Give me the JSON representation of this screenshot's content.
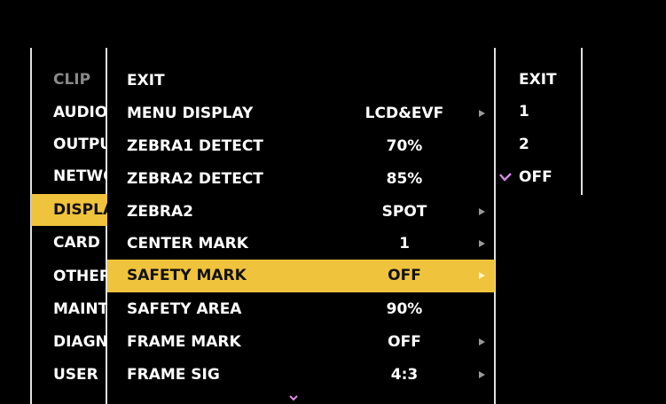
{
  "left_menu": {
    "items": [
      {
        "label": "CLIP"
      },
      {
        "label": "AUDIO"
      },
      {
        "label": "OUTPUT"
      },
      {
        "label": "NETWORK"
      },
      {
        "label": "DISPLAY"
      },
      {
        "label": "CARD"
      },
      {
        "label": "OTHERS"
      },
      {
        "label": "MAINTENANCE"
      },
      {
        "label": "DIAGNOSTIC"
      },
      {
        "label": "USER"
      }
    ],
    "selected": "DISPLAY",
    "dimmed": "CLIP"
  },
  "middle_menu": {
    "items": [
      {
        "label": "EXIT",
        "value": ""
      },
      {
        "label": "MENU DISPLAY",
        "value": "LCD&EVF"
      },
      {
        "label": "ZEBRA1 DETECT",
        "value": "70%"
      },
      {
        "label": "ZEBRA2 DETECT",
        "value": "85%"
      },
      {
        "label": "ZEBRA2",
        "value": "SPOT"
      },
      {
        "label": "CENTER MARK",
        "value": "1"
      },
      {
        "label": "SAFETY MARK",
        "value": "OFF"
      },
      {
        "label": "SAFETY AREA",
        "value": "90%"
      },
      {
        "label": "FRAME MARK",
        "value": "OFF"
      },
      {
        "label": "FRAME SIG",
        "value": "4:3"
      }
    ],
    "highlighted": "SAFETY MARK",
    "more_icon": "chevron-down-icon",
    "submenu_icon": "triangle-right-icon"
  },
  "right_menu": {
    "items": [
      {
        "label": "EXIT",
        "checked": false
      },
      {
        "label": "1",
        "checked": false
      },
      {
        "label": "2",
        "checked": false
      },
      {
        "label": "OFF",
        "checked": true
      }
    ],
    "check_icon": "checkmark-icon"
  },
  "colors": {
    "background": "#000000",
    "highlight": "#f0c33c",
    "text": "#ffffff",
    "dim_text": "#8a8a8a",
    "check": "#d98be6",
    "chevron": "#e08fe6"
  }
}
